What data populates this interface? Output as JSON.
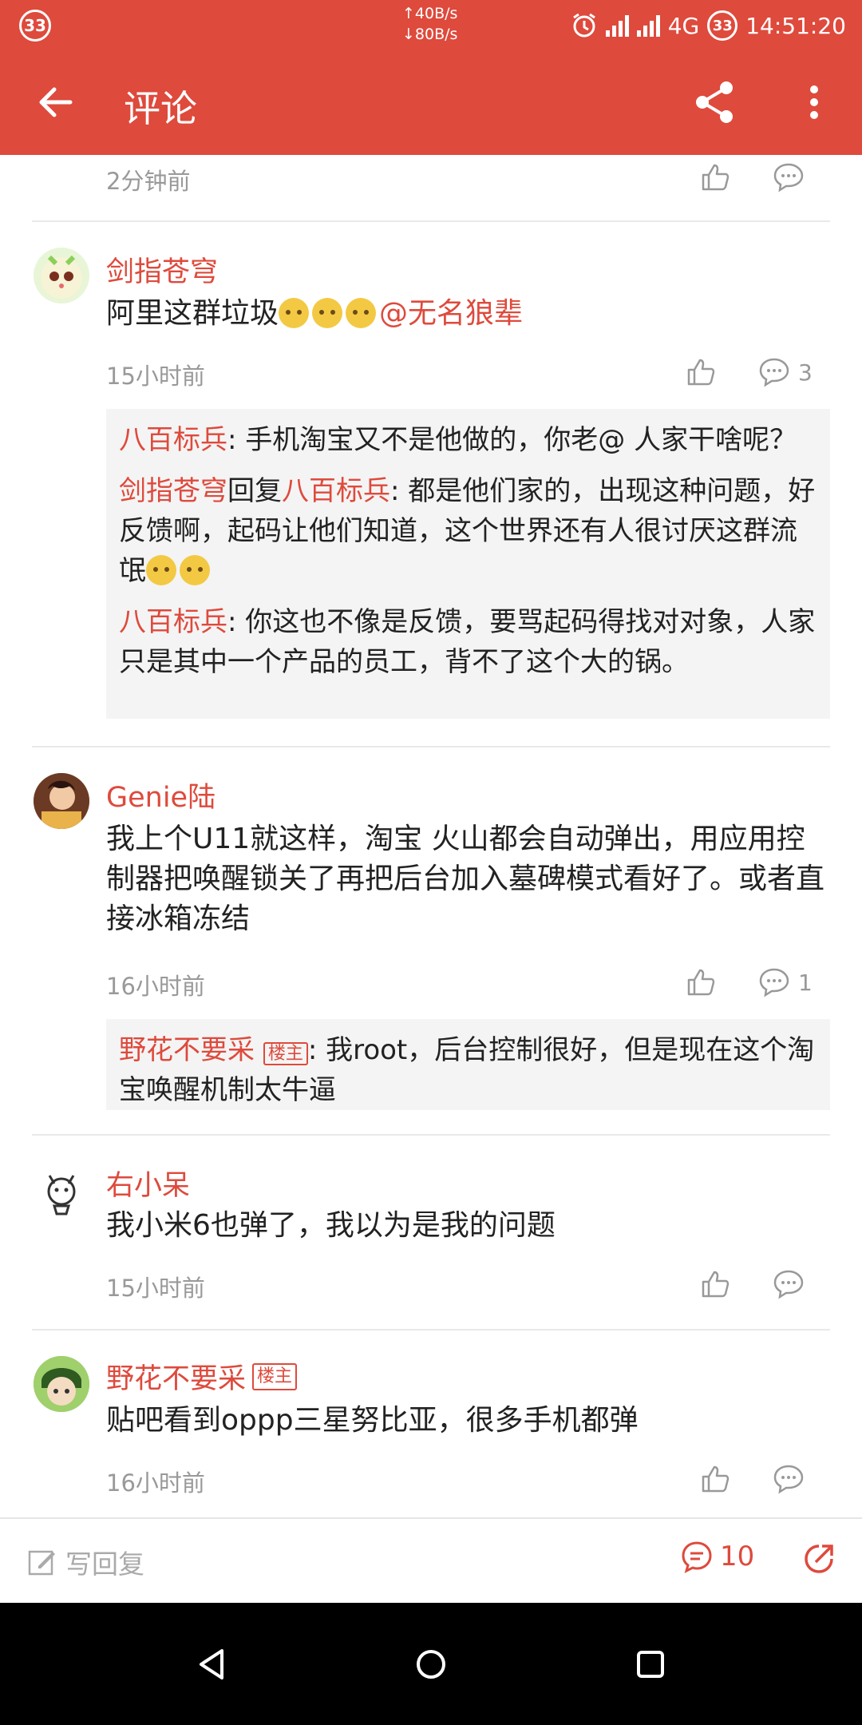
{
  "status_bar": {
    "notif_count": "33",
    "net_up": "↑40B/s",
    "net_down": "↓80B/s",
    "network": "4G",
    "battery": "33",
    "time": "14:51:20"
  },
  "appbar": {
    "title": "评论",
    "back_icon": "arrow-left-icon",
    "share_icon": "share-icon",
    "more_icon": "more-vert-icon"
  },
  "top_partial": {
    "time": "2分钟前"
  },
  "comments": [
    {
      "user": "剑指苍穹",
      "text_plain": "阿里这群垃圾",
      "mention": "@无名狼辈",
      "time": "15小时前",
      "reply_count": "3",
      "replies": [
        {
          "user": "八百标兵",
          "sep": ": ",
          "text": "手机淘宝又不是他做的，你老@ 人家干啥呢？"
        },
        {
          "user": "剑指苍穹",
          "mid": "回复",
          "target": "八百标兵",
          "sep": ": ",
          "text": "都是他们家的，出现这种问题，好反馈啊，起码让他们知道，这个世界还有人很讨厌这群流氓"
        },
        {
          "user": "八百标兵",
          "sep": ": ",
          "text": "你这也不像是反馈，要骂起码得找对对象，人家只是其中一个产品的员工，背不了这个大的锅。"
        }
      ]
    },
    {
      "user": "Genie陆",
      "text": "我上个U11就这样，淘宝 火山都会自动弹出，用应用控制器把唤醒锁关了再把后台加入墓碑模式看好了。或者直接冰箱冻结",
      "time": "16小时前",
      "reply_count": "1",
      "replies": [
        {
          "user": "野花不要采",
          "host_tag": "楼主",
          "sep": ": ",
          "text": "我root，后台控制很好，但是现在这个淘宝唤醒机制太牛逼"
        }
      ]
    },
    {
      "user": "右小呆",
      "text": "我小米6也弹了，我以为是我的问题",
      "time": "15小时前"
    },
    {
      "user": "野花不要采",
      "host_tag": "楼主",
      "text": "贴吧看到oppp三星努比亚，很多手机都弹",
      "time": "16小时前"
    }
  ],
  "bottom_bar": {
    "placeholder": "写回复",
    "comment_count": "10"
  }
}
